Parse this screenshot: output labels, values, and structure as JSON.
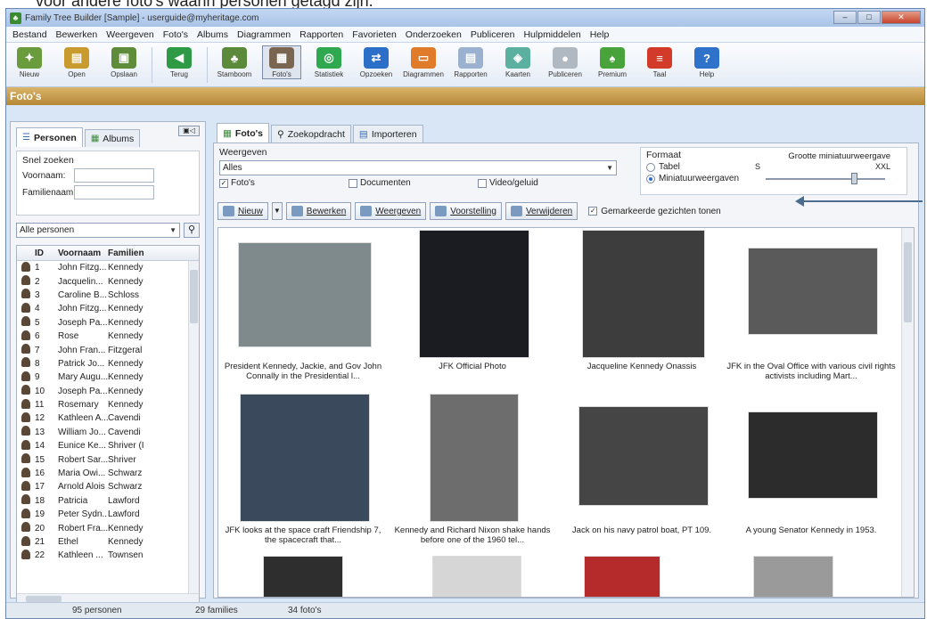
{
  "top_text": "voor andere foto's waarin personen getagd zijn.",
  "title": "Family Tree Builder [Sample] - userguide@myheritage.com",
  "menu": [
    "Bestand",
    "Bewerken",
    "Weergeven",
    "Foto's",
    "Albums",
    "Diagrammen",
    "Rapporten",
    "Favorieten",
    "Onderzoeken",
    "Publiceren",
    "Hulpmiddelen",
    "Help"
  ],
  "toolbar": [
    {
      "label": "Nieuw",
      "color": "#6a9b3d",
      "glyph": "✦"
    },
    {
      "label": "Open",
      "color": "#c99a2e",
      "glyph": "▤"
    },
    {
      "label": "Opslaan",
      "color": "#5f8c3a",
      "glyph": "▣"
    },
    {
      "label": "Terug",
      "color": "#2e9a45",
      "glyph": "◀"
    },
    {
      "label": "Stamboom",
      "color": "#5b8a3a",
      "glyph": "♣"
    },
    {
      "label": "Foto's",
      "color": "#7a6650",
      "glyph": "▦"
    },
    {
      "label": "Statistiek",
      "color": "#2ea94f",
      "glyph": "◎"
    },
    {
      "label": "Opzoeken",
      "color": "#2c6fc9",
      "glyph": "⇄"
    },
    {
      "label": "Diagrammen",
      "color": "#e07b2a",
      "glyph": "▭"
    },
    {
      "label": "Rapporten",
      "color": "#9ab2cf",
      "glyph": "▤"
    },
    {
      "label": "Kaarten",
      "color": "#5cb0a0",
      "glyph": "◈"
    },
    {
      "label": "Publiceren",
      "color": "#b0b8c2",
      "glyph": "●"
    },
    {
      "label": "Premium",
      "color": "#47a33a",
      "glyph": "♠"
    },
    {
      "label": "Taal",
      "color": "#d23b2a",
      "glyph": "≡"
    },
    {
      "label": "Help",
      "color": "#2f72c9",
      "glyph": "?"
    }
  ],
  "section_title": "Foto's",
  "left": {
    "tab_persons": "Personen",
    "tab_albums": "Albums",
    "quick_search": "Snel zoeken",
    "first_name_label": "Voornaam:",
    "last_name_label": "Familienaam:",
    "filter": "Alle personen",
    "columns": [
      "ID",
      "Voornaam",
      "Familien"
    ],
    "rows": [
      [
        "1",
        "John Fitzg...",
        "Kennedy"
      ],
      [
        "2",
        "Jacquelin...",
        "Kennedy"
      ],
      [
        "3",
        "Caroline B...",
        "Schloss"
      ],
      [
        "4",
        "John Fitzg...",
        "Kennedy"
      ],
      [
        "5",
        "Joseph Pa...",
        "Kennedy"
      ],
      [
        "6",
        "Rose",
        "Kennedy"
      ],
      [
        "7",
        "John Fran...",
        "Fitzgeral"
      ],
      [
        "8",
        "Patrick Jo...",
        "Kennedy"
      ],
      [
        "9",
        "Mary Augu...",
        "Kennedy"
      ],
      [
        "10",
        "Joseph Pa...",
        "Kennedy"
      ],
      [
        "11",
        "Rosemary",
        "Kennedy"
      ],
      [
        "12",
        "Kathleen A...",
        "Cavendi"
      ],
      [
        "13",
        "William Jo...",
        "Cavendi"
      ],
      [
        "14",
        "Eunice Ke...",
        "Shriver (I"
      ],
      [
        "15",
        "Robert Sar...",
        "Shriver"
      ],
      [
        "16",
        "Maria Owi...",
        "Schwarz"
      ],
      [
        "17",
        "Arnold Alois",
        "Schwarz"
      ],
      [
        "18",
        "Patricia",
        "Lawford"
      ],
      [
        "19",
        "Peter Sydn...",
        "Lawford"
      ],
      [
        "20",
        "Robert Fra...",
        "Kennedy"
      ],
      [
        "21",
        "Ethel",
        "Kennedy"
      ],
      [
        "22",
        "Kathleen ...",
        "Townsen"
      ]
    ]
  },
  "right": {
    "tab_photos": "Foto's",
    "tab_search": "Zoekopdracht",
    "tab_import": "Importeren",
    "view_label": "Weergeven",
    "view_value": "Alles",
    "check_photos": "Foto's",
    "check_docs": "Documenten",
    "check_av": "Video/geluid",
    "format_label": "Formaat",
    "size_label": "Grootte miniatuurweergave",
    "size_min": "S",
    "size_max": "XXL",
    "radio_table": "Tabel",
    "radio_thumbs": "Miniatuurweergaven",
    "btn_new": "Nieuw",
    "btn_edit": "Bewerken",
    "btn_view": "Weergeven",
    "btn_slideshow": "Voorstelling",
    "btn_delete": "Verwijderen",
    "faces_check": "Gemarkeerde gezichten tonen"
  },
  "photos": [
    {
      "caption": "President Kennedy, Jackie, and Gov John Connally in the Presidential l..."
    },
    {
      "caption": "JFK Official Photo"
    },
    {
      "caption": "Jacqueline Kennedy Onassis"
    },
    {
      "caption": "JFK in the Oval Office with various civil rights activists including Mart..."
    },
    {
      "caption": "JFK looks at the space craft Friendship 7, the spacecraft that..."
    },
    {
      "caption": "Kennedy and Richard Nixon shake hands before one of the 1960 tel..."
    },
    {
      "caption": "Jack on his navy patrol boat, PT 109."
    },
    {
      "caption": "A young Senator Kennedy in 1953."
    }
  ],
  "status": {
    "persons": "95 personen",
    "families": "29 families",
    "photos": "34 foto's"
  }
}
